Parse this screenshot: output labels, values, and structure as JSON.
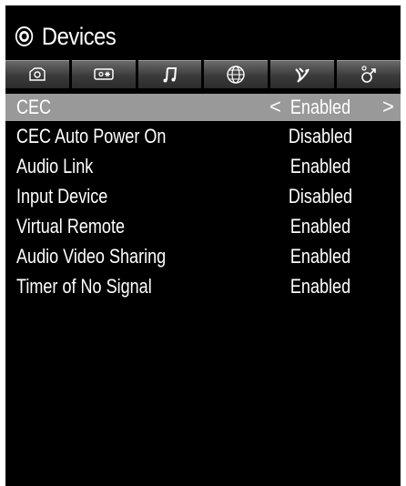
{
  "header": {
    "title": "Devices",
    "icon": "gear-icon"
  },
  "tabs": [
    {
      "name": "picture-tab",
      "icon": "camera-icon"
    },
    {
      "name": "screen-tab",
      "icon": "screen-setting-icon"
    },
    {
      "name": "sound-tab",
      "icon": "music-note-icon"
    },
    {
      "name": "network-tab",
      "icon": "globe-icon"
    },
    {
      "name": "satellite-tab",
      "icon": "satellite-icon"
    },
    {
      "name": "system-tab",
      "icon": "gender-symbol-icon"
    }
  ],
  "settings": {
    "selected_index": 0,
    "left_arrow": "<",
    "right_arrow": ">",
    "items": [
      {
        "label": "CEC",
        "value": "Enabled"
      },
      {
        "label": "CEC Auto Power On",
        "value": "Disabled"
      },
      {
        "label": "Audio Link",
        "value": "Enabled"
      },
      {
        "label": "Input Device",
        "value": "Disabled"
      },
      {
        "label": "Virtual Remote",
        "value": "Enabled"
      },
      {
        "label": "Audio Video Sharing",
        "value": "Enabled"
      },
      {
        "label": "Timer of No Signal",
        "value": "Enabled"
      }
    ]
  },
  "colors": {
    "background": "#000000",
    "highlight": "#999999",
    "text": "#ffffff"
  }
}
